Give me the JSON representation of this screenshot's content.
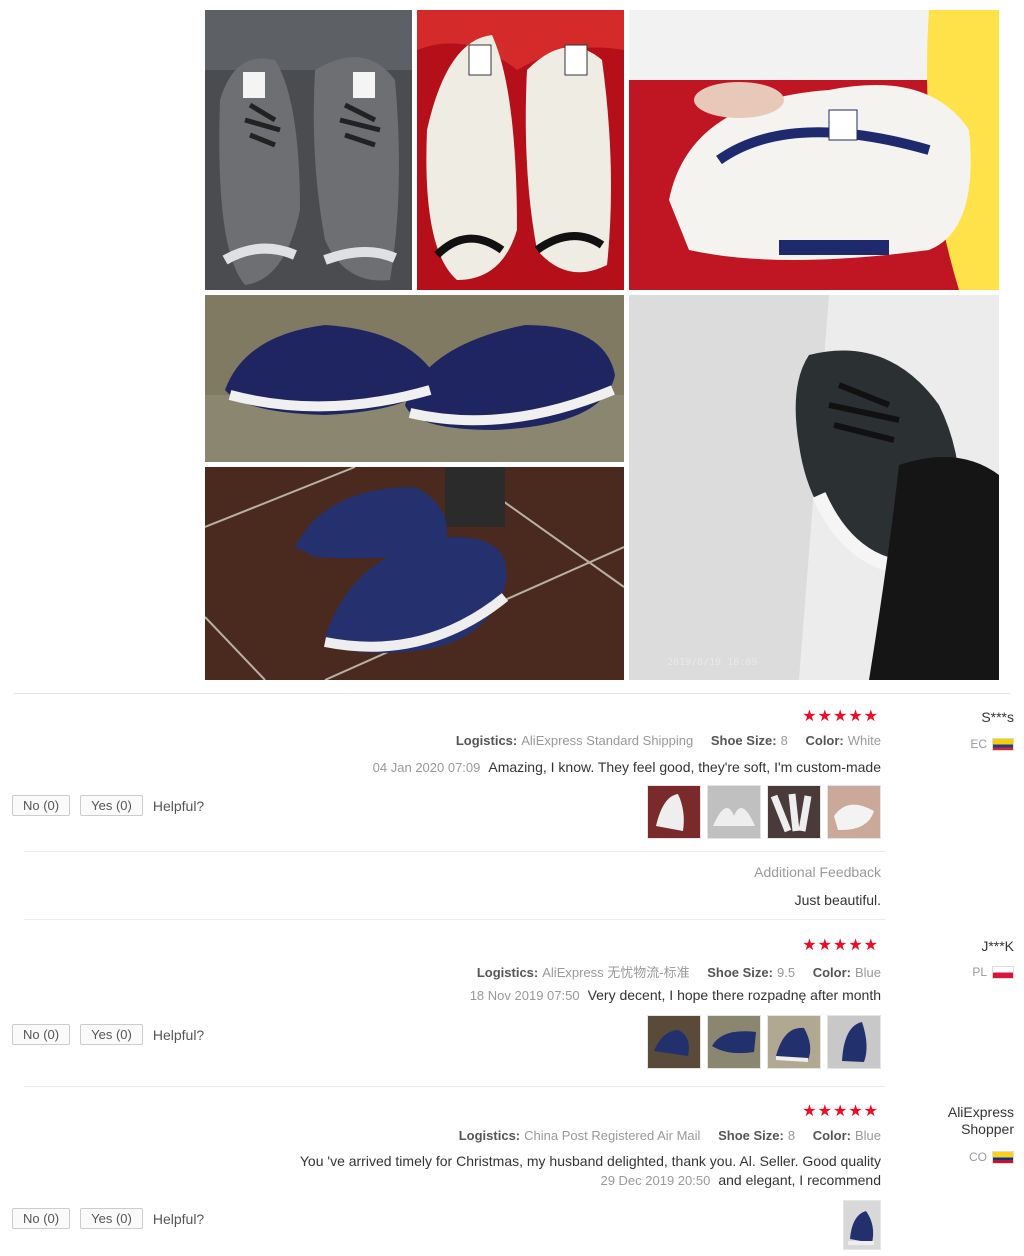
{
  "gallery": {
    "photo5_timestamp": "2019/8/19 16:09"
  },
  "helpful_label": "Helpful?",
  "reviews": [
    {
      "user": "S***s",
      "country": "EC",
      "flag_colors": [
        "#f4d000",
        "#1e3a96",
        "#d8232a"
      ],
      "rating": 5,
      "stars": "★★★★★",
      "color_label": "Color:",
      "color_value": "White",
      "size_label": "Shoe Size:",
      "size_value": "8",
      "logistics_label": "Logistics:",
      "logistics_value": "AliExpress Standard Shipping",
      "text": "Amazing, I know. They feel good, they're soft, I'm custom-made",
      "date": "04 Jan 2020 07:09",
      "thumb_icons": [
        "shoe-photo",
        "shoe-photo",
        "shoe-photo",
        "shoe-photo"
      ],
      "yes": "Yes (0)",
      "no": "No (0)",
      "additional_label": "Additional Feedback",
      "additional_text": "Just beautiful."
    },
    {
      "user": "J***K",
      "country": "PL",
      "flag_colors": [
        "#ffffff",
        "#dc143c"
      ],
      "rating": 5,
      "stars": "★★★★★",
      "color_label": "Color:",
      "color_value": "Blue",
      "size_label": "Shoe Size:",
      "size_value": "9.5",
      "logistics_label": "Logistics:",
      "logistics_value": "AliExpress 无忧物流-标准",
      "text": "Very decent, I hope there rozpadnę after month",
      "date": "18 Nov 2019 07:50",
      "thumb_icons": [
        "shoe-photo",
        "shoe-photo",
        "shoe-photo",
        "shoe-photo"
      ],
      "yes": "Yes (0)",
      "no": "No (0)"
    },
    {
      "user": "AliExpress Shopper",
      "country": "CO",
      "flag_colors": [
        "#fcd116",
        "#003893",
        "#ce1126"
      ],
      "rating": 5,
      "stars": "★★★★★",
      "color_label": "Color:",
      "color_value": "Blue",
      "size_label": "Shoe Size:",
      "size_value": "8",
      "logistics_label": "Logistics:",
      "logistics_value": "China Post Registered Air Mail",
      "text_line1": "You 've arrived timely for Christmas, my husband delighted, thank you. Al. Seller. Good quality",
      "text_line2": "and elegant, I recommend",
      "date": "29 Dec 2019 20:50",
      "thumb_icons": [
        "shoe-photo"
      ],
      "yes": "Yes (0)",
      "no": "No (0)"
    }
  ]
}
